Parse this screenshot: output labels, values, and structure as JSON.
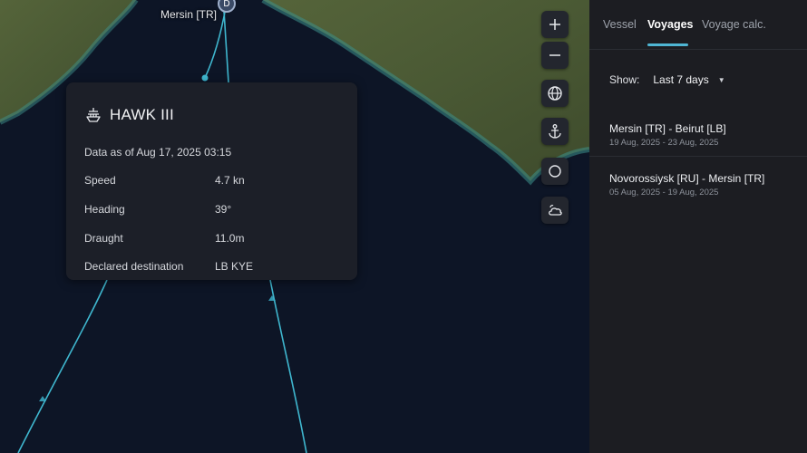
{
  "map": {
    "port_label": "Mersin [TR]",
    "port_marker_letter": "D"
  },
  "vessel_card": {
    "name": "HAWK III",
    "data_as_of": "Data as of Aug 17, 2025 03:15",
    "fields": [
      {
        "label": "Speed",
        "value": "4.7 kn"
      },
      {
        "label": "Heading",
        "value": "39°"
      },
      {
        "label": "Draught",
        "value": "11.0m"
      },
      {
        "label": "Declared destination",
        "value": "LB KYE"
      }
    ]
  },
  "map_controls": [
    {
      "icon": "zoom-in-icon"
    },
    {
      "icon": "zoom-out-icon"
    },
    {
      "icon": "globe-icon"
    },
    {
      "icon": "anchor-icon"
    },
    {
      "icon": "circle-icon"
    },
    {
      "icon": "weather-icon"
    }
  ],
  "panel": {
    "tabs": [
      "Vessel",
      "Voyages",
      "Voyage calc."
    ],
    "active_tab": "Voyages",
    "show_label": "Show:",
    "show_value": "Last 7 days",
    "voyages": [
      {
        "route": "Mersin [TR] - Beirut [LB]",
        "dates": "19 Aug, 2025 - 23 Aug, 2025"
      },
      {
        "route": "Novorossiysk [RU] - Mersin [TR]",
        "dates": "05 Aug, 2025 - 19 Aug, 2025"
      }
    ]
  },
  "colors": {
    "accent": "#4fb6d4",
    "track": "#3fb7cf",
    "sea": "#0d1526",
    "land": "#4b5a34",
    "panel_bg": "#1c1d22",
    "card_bg": "#1e2028"
  }
}
